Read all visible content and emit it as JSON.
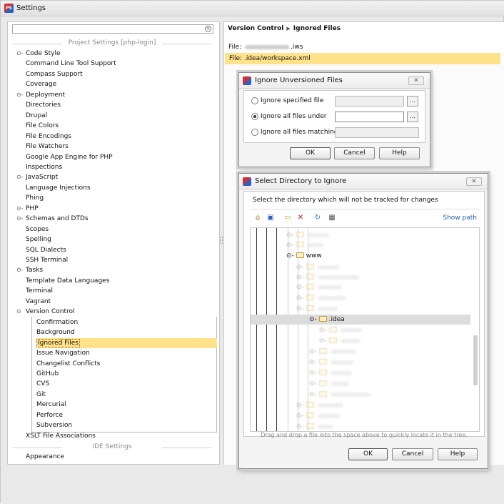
{
  "window": {
    "title": "Settings"
  },
  "left": {
    "search_placeholder": "",
    "project_header": "Project Settings [php-login]",
    "ide_header": "IDE Settings",
    "items": [
      {
        "label": "Code Style",
        "expander": "⊙-"
      },
      {
        "label": "Command Line Tool Support",
        "expander": ""
      },
      {
        "label": "Compass Support",
        "expander": ""
      },
      {
        "label": "Coverage",
        "expander": ""
      },
      {
        "label": "Deployment",
        "expander": "⊙-"
      },
      {
        "label": "Directories",
        "expander": ""
      },
      {
        "label": "Drupal",
        "expander": ""
      },
      {
        "label": "File Colors",
        "expander": ""
      },
      {
        "label": "File Encodings",
        "expander": ""
      },
      {
        "label": "File Watchers",
        "expander": ""
      },
      {
        "label": "Google App Engine for PHP",
        "expander": ""
      },
      {
        "label": "Inspections",
        "expander": ""
      },
      {
        "label": "JavaScript",
        "expander": "⊙-"
      },
      {
        "label": "Language Injections",
        "expander": ""
      },
      {
        "label": "Phing",
        "expander": ""
      },
      {
        "label": "PHP",
        "expander": "⊙-"
      },
      {
        "label": "Schemas and DTDs",
        "expander": "⊙-"
      },
      {
        "label": "Scopes",
        "expander": ""
      },
      {
        "label": "Spelling",
        "expander": ""
      },
      {
        "label": "SQL Dialects",
        "expander": ""
      },
      {
        "label": "SSH Terminal",
        "expander": ""
      },
      {
        "label": "Tasks",
        "expander": "⊙-"
      },
      {
        "label": "Template Data Languages",
        "expander": ""
      },
      {
        "label": "Terminal",
        "expander": ""
      },
      {
        "label": "Vagrant",
        "expander": ""
      },
      {
        "label": "Version Control",
        "expander": "⊙"
      }
    ],
    "vcs_children": [
      "Confirmation",
      "Background",
      "Ignored Files",
      "Issue Navigation",
      "Changelist Conflicts",
      "GitHub",
      "CVS",
      "Git",
      "Mercurial",
      "Perforce",
      "Subversion"
    ],
    "selected_child": "Ignored Files",
    "after_items": [
      "XSLT File Associations"
    ],
    "ide_items": [
      "Appearance"
    ]
  },
  "right": {
    "crumb1": "Version Control",
    "crumb2": "Ignored Files",
    "file1_prefix": "File:",
    "file1_suffix": ".iws",
    "file2": "File: .idea/workspace.xml"
  },
  "ignore_dialog": {
    "title": "Ignore Unversioned Files",
    "opt1": "Ignore specified file",
    "opt2": "Ignore all files under",
    "opt3": "Ignore all files matching",
    "browse": "...",
    "ok": "OK",
    "cancel": "Cancel",
    "help": "Help"
  },
  "dir_dialog": {
    "title": "Select Directory to Ignore",
    "subtitle": "Select the directory which will not be tracked for changes",
    "show_path": "Show path",
    "node_www": "www",
    "node_idea": ".idea",
    "hint": "Drag and drop a file into the space above to quickly locate it in the tree.",
    "ok": "OK",
    "cancel": "Cancel",
    "help": "Help"
  },
  "colors": {
    "selection": "#ffe28a",
    "link": "#1f5fb0"
  }
}
